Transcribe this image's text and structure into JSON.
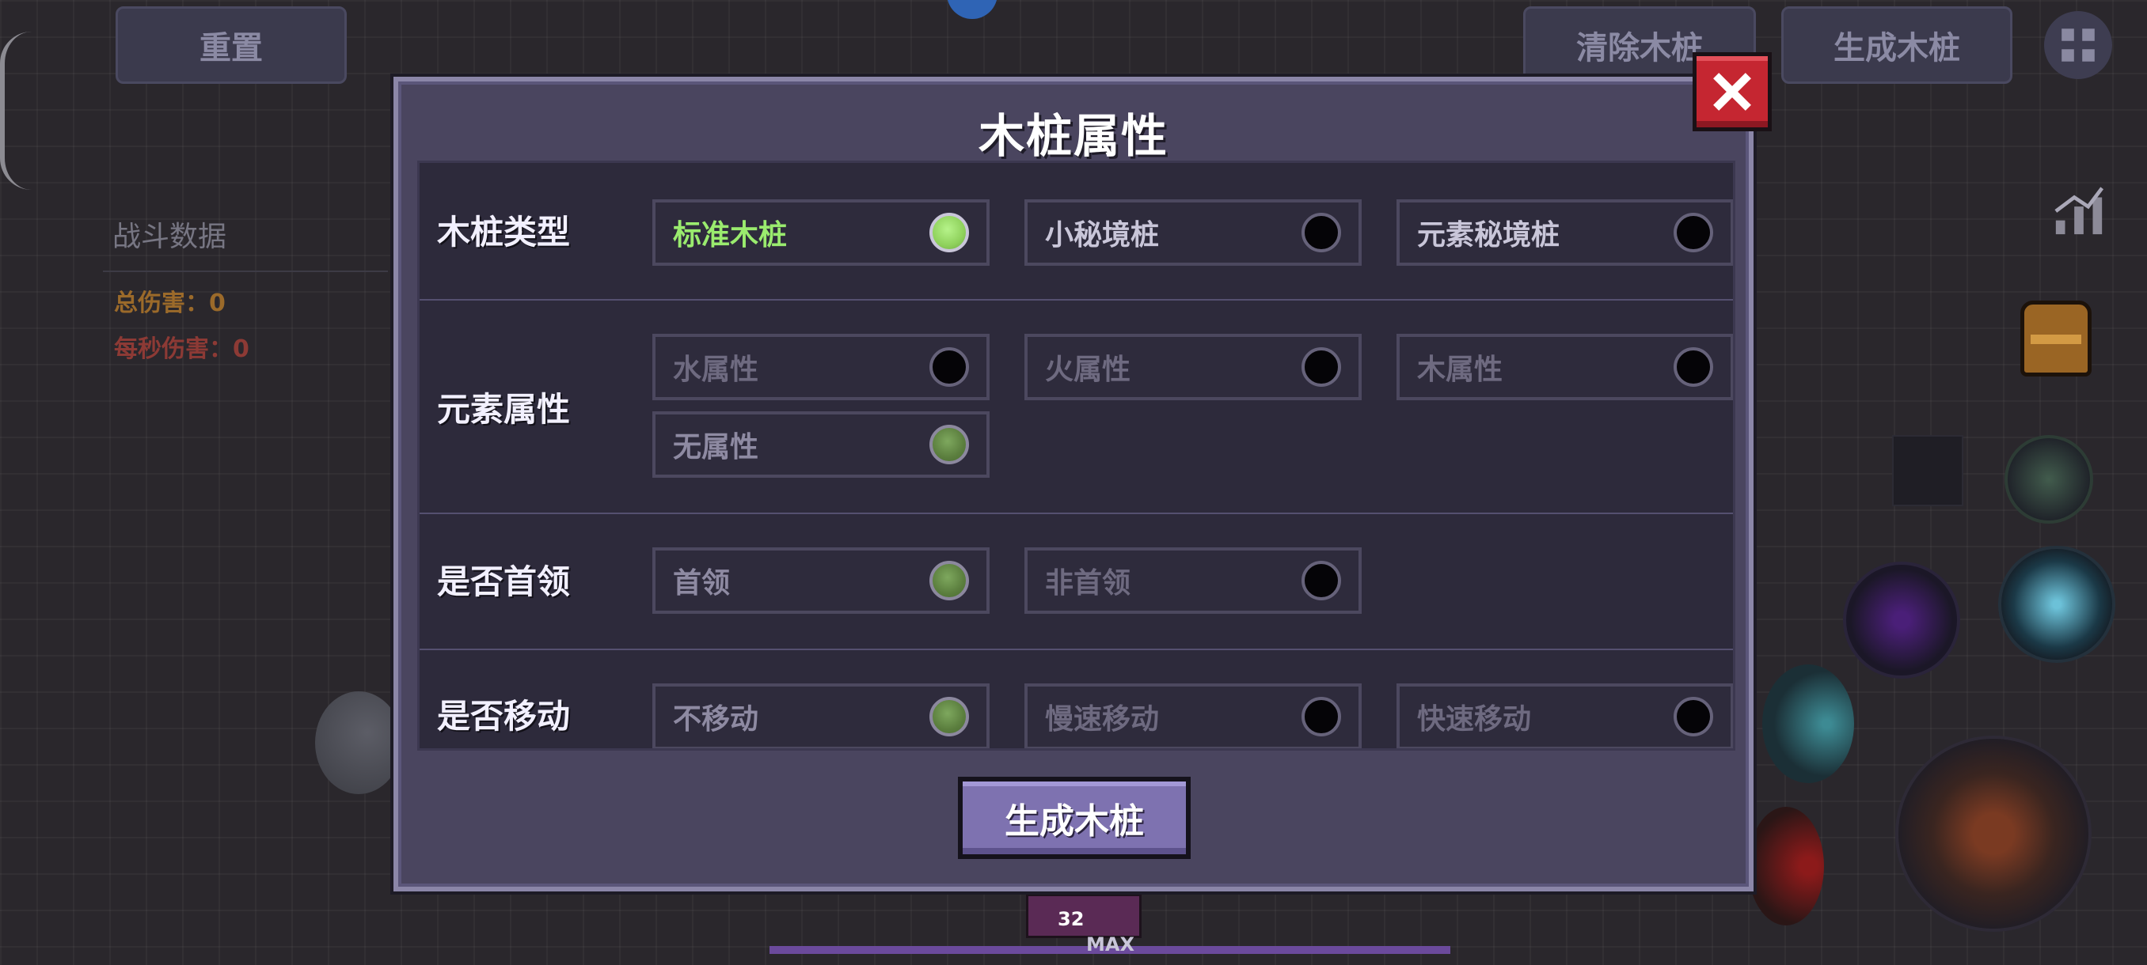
{
  "hud": {
    "reset_label": "重置",
    "clear_label": "清除木桩",
    "spawn_label": "生成木桩",
    "level": "32",
    "max_label": "MAX"
  },
  "stats": {
    "title": "战斗数据",
    "total_damage": "总伤害：0",
    "dps": "每秒伤害：0"
  },
  "dialog": {
    "title": "木桩属性",
    "confirm_label": "生成木桩",
    "sections": [
      {
        "label": "木桩类型",
        "options": [
          {
            "label": "标准木桩",
            "selected": true
          },
          {
            "label": "小秘境桩",
            "selected": false
          },
          {
            "label": "元素秘境桩",
            "selected": false
          }
        ]
      },
      {
        "label": "元素属性",
        "options": [
          {
            "label": "水属性",
            "selected": false
          },
          {
            "label": "火属性",
            "selected": false
          },
          {
            "label": "木属性",
            "selected": false
          },
          {
            "label": "无属性",
            "selected": true
          }
        ]
      },
      {
        "label": "是否首领",
        "options": [
          {
            "label": "首领",
            "selected": true
          },
          {
            "label": "非首领",
            "selected": false
          }
        ]
      },
      {
        "label": "是否移动",
        "options": [
          {
            "label": "不移动",
            "selected": true
          },
          {
            "label": "慢速移动",
            "selected": false
          },
          {
            "label": "快速移动",
            "selected": false
          }
        ]
      }
    ]
  },
  "colors": {
    "accent_green": "#9aeb6e",
    "close_red": "#c52631",
    "button_purple": "#7e72b0",
    "total_damage": "#9b6a2a",
    "dps": "#8d3a35"
  }
}
